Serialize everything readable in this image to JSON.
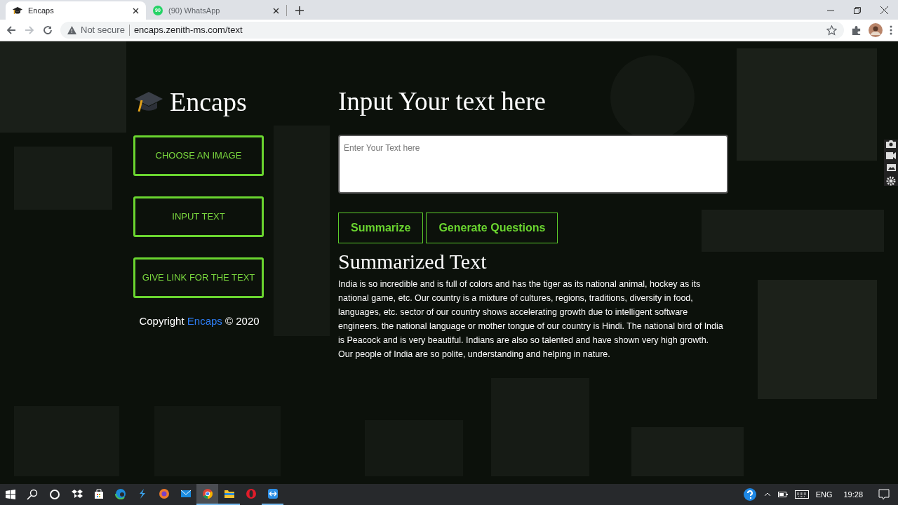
{
  "browser": {
    "tabs": [
      {
        "title": "Encaps",
        "kind": "site",
        "selected": true
      },
      {
        "title": "(90) WhatsApp",
        "kind": "chat",
        "badge": "90",
        "selected": false
      }
    ],
    "address": {
      "security": "Not secure",
      "url": "encaps.zenith-ms.com/text"
    }
  },
  "sidebar": {
    "brand": "Encaps",
    "items": [
      {
        "label": "CHOOSE AN IMAGE"
      },
      {
        "label": "INPUT TEXT"
      },
      {
        "label": "GIVE LINK FOR THE TEXT"
      }
    ],
    "copyright": {
      "prefix": "Copyright",
      "link": "Encaps",
      "suffix": "© 2020"
    }
  },
  "main": {
    "heading": "Input Your text here",
    "input": {
      "placeholder": "Enter Your Text here"
    },
    "actions": [
      "Summarize",
      "Generate Questions"
    ],
    "result_heading": "Summarized Text",
    "result_text": "India is so incredible and is full of colors and has the tiger as its national animal, hockey as its national game, etc. Our country is a mixture of cultures, regions, traditions, diversity in food, languages, etc. sector of our country shows accelerating growth due to intelligent software engineers. the national language or mother tongue of our country is Hindi. The national bird of India is Peacock and is very beautiful. Indians are also so talented and have shown very high growth. Our people of India are so polite, understanding and helping in nature."
  },
  "taskbar": {
    "apps": [
      {
        "kind": "dropbox",
        "running": false,
        "active": false
      },
      {
        "kind": "store",
        "running": false,
        "active": false
      },
      {
        "kind": "edge",
        "running": false,
        "active": false
      },
      {
        "kind": "bolt",
        "running": false,
        "active": false
      },
      {
        "kind": "brave",
        "running": false,
        "active": false
      },
      {
        "kind": "mail",
        "running": false,
        "active": false
      },
      {
        "kind": "chrome",
        "running": true,
        "active": true
      },
      {
        "kind": "folder",
        "running": true,
        "active": false
      },
      {
        "kind": "opera",
        "running": false,
        "active": false
      },
      {
        "kind": "remote",
        "running": true,
        "active": false
      }
    ],
    "language": "ENG",
    "time": "19:28"
  }
}
